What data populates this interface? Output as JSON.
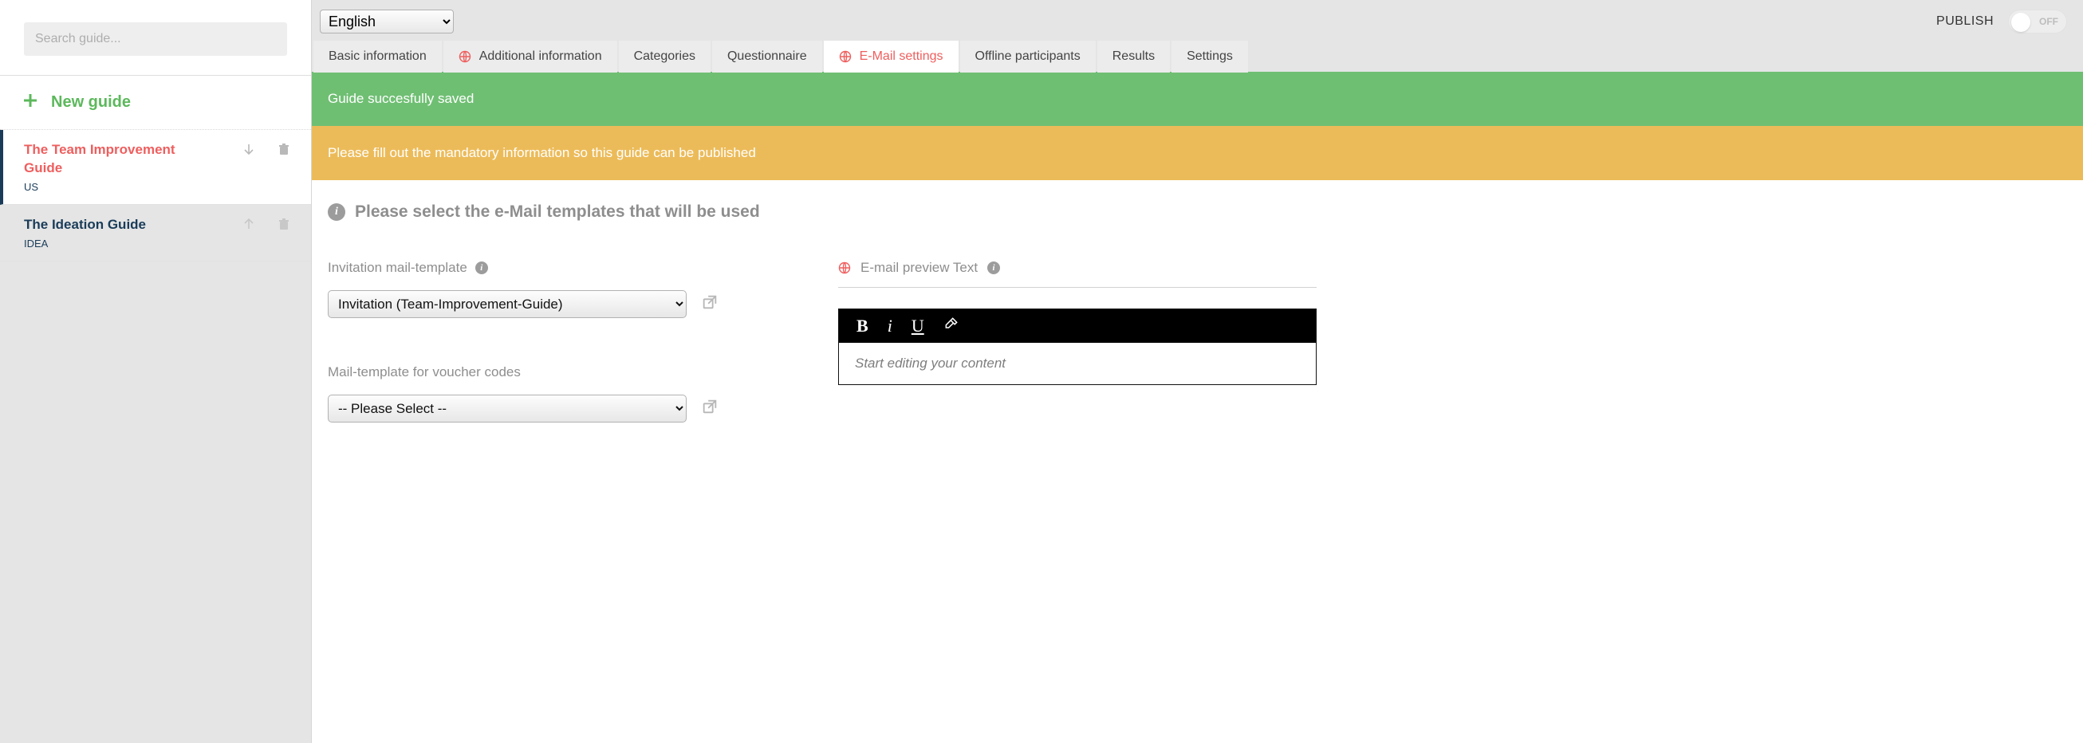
{
  "sidebar": {
    "search_placeholder": "Search guide...",
    "new_guide_label": "New guide",
    "guides": [
      {
        "title": "The Team Improvement Guide",
        "code": "US",
        "sort_dir": "down",
        "active": true
      },
      {
        "title": "The Ideation Guide",
        "code": "IDEA",
        "sort_dir": "up",
        "active": false
      }
    ]
  },
  "topbar": {
    "language_selected": "English",
    "publish_label": "PUBLISH",
    "toggle_text": "OFF"
  },
  "tabs": [
    {
      "label": "Basic information",
      "globe": false,
      "active": false
    },
    {
      "label": "Additional information",
      "globe": true,
      "active": false
    },
    {
      "label": "Categories",
      "globe": false,
      "active": false
    },
    {
      "label": "Questionnaire",
      "globe": false,
      "active": false
    },
    {
      "label": "E-Mail settings",
      "globe": true,
      "active": true
    },
    {
      "label": "Offline participants",
      "globe": false,
      "active": false
    },
    {
      "label": "Results",
      "globe": false,
      "active": false
    },
    {
      "label": "Settings",
      "globe": false,
      "active": false
    }
  ],
  "banners": {
    "success": "Guide succesfully saved",
    "warn": "Please fill out the mandatory information so this guide can be published"
  },
  "emailSettings": {
    "heading": "Please select the e-Mail templates that will be used",
    "invitation_label": "Invitation mail-template",
    "invitation_selected": "Invitation (Team-Improvement-Guide)",
    "voucher_label": "Mail-template for voucher codes",
    "voucher_selected": "-- Please Select --",
    "preview_label": "E-mail preview Text",
    "editor_placeholder": "Start editing your content"
  }
}
